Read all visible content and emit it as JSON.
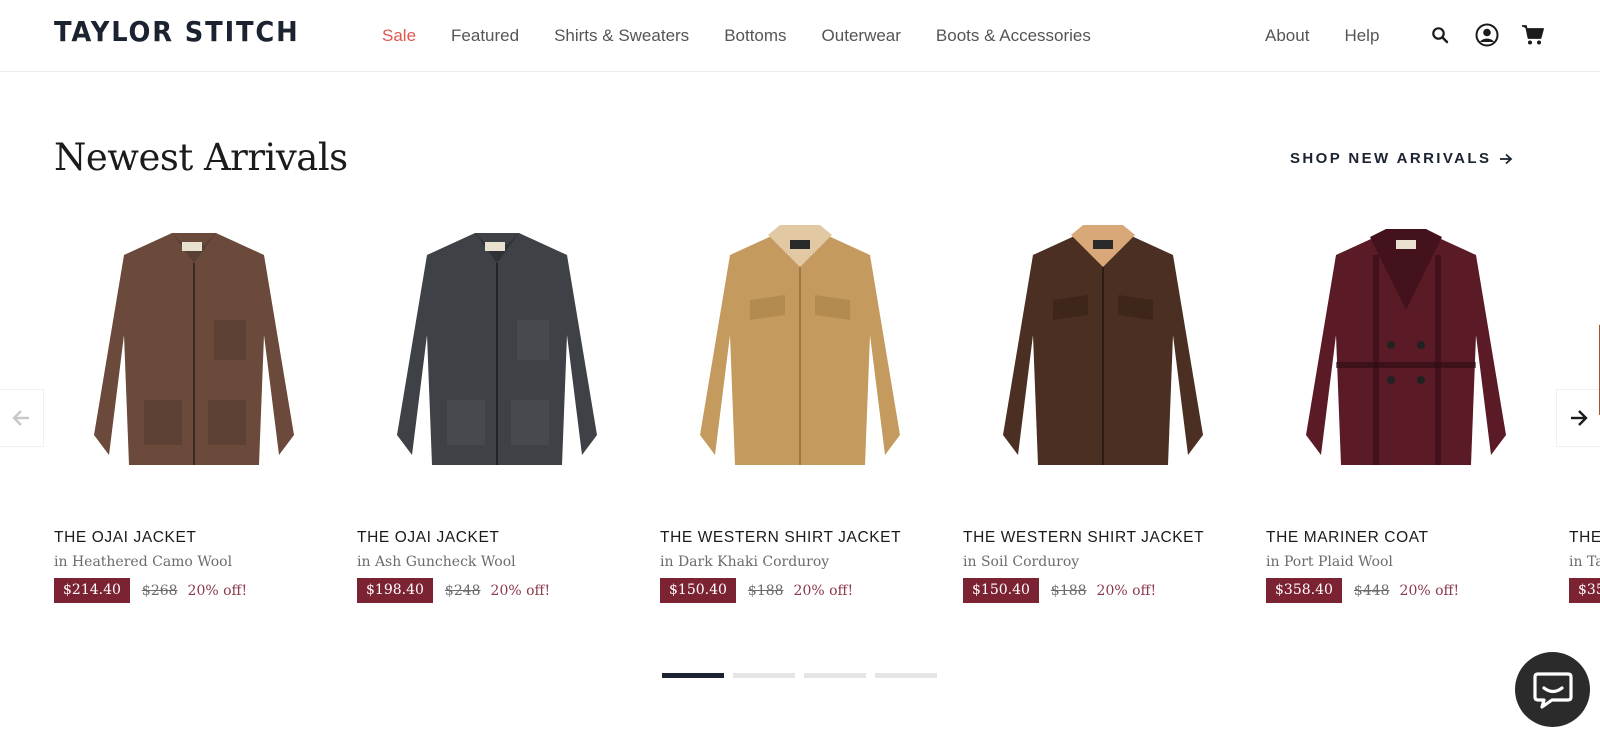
{
  "header": {
    "logo": "TAYLOR STITCH",
    "nav": [
      "Sale",
      "Featured",
      "Shirts & Sweaters",
      "Bottoms",
      "Outerwear",
      "Boots & Accessories"
    ],
    "nav_right": [
      "About",
      "Help"
    ],
    "icons": [
      "search-icon",
      "account-icon",
      "cart-icon"
    ]
  },
  "section": {
    "title": "Newest Arrivals",
    "shop_link": "SHOP NEW ARRIVALS"
  },
  "products": [
    {
      "name": "THE OJAI JACKET",
      "color": "in Heathered Camo Wool",
      "sale_price": "$214.40",
      "original_price": "$268",
      "discount": "20% off!",
      "swatch": "#6b4a3c"
    },
    {
      "name": "THE OJAI JACKET",
      "color": "in Ash Guncheck Wool",
      "sale_price": "$198.40",
      "original_price": "$248",
      "discount": "20% off!",
      "swatch": "#3e4246"
    },
    {
      "name": "THE WESTERN SHIRT JACKET",
      "color": "in Dark Khaki Corduroy",
      "sale_price": "$150.40",
      "original_price": "$188",
      "discount": "20% off!",
      "swatch": "#c49a5e"
    },
    {
      "name": "THE WESTERN SHIRT JACKET",
      "color": "in Soil Corduroy",
      "sale_price": "$150.40",
      "original_price": "$188",
      "discount": "20% off!",
      "swatch": "#4a2f22"
    },
    {
      "name": "THE MARINER COAT",
      "color": "in Port Plaid Wool",
      "sale_price": "$358.40",
      "original_price": "$448",
      "discount": "20% off!",
      "swatch": "#5a1a26"
    },
    {
      "name": "THE",
      "color": "in Ta",
      "sale_price": "$35",
      "original_price": "",
      "discount": "",
      "swatch": "#a0582e"
    }
  ],
  "carousel": {
    "pages": 4,
    "active_page": 1
  },
  "colors": {
    "sale_nav": "#e0574f",
    "price_badge": "#7b2333",
    "navy": "#1b2330"
  }
}
